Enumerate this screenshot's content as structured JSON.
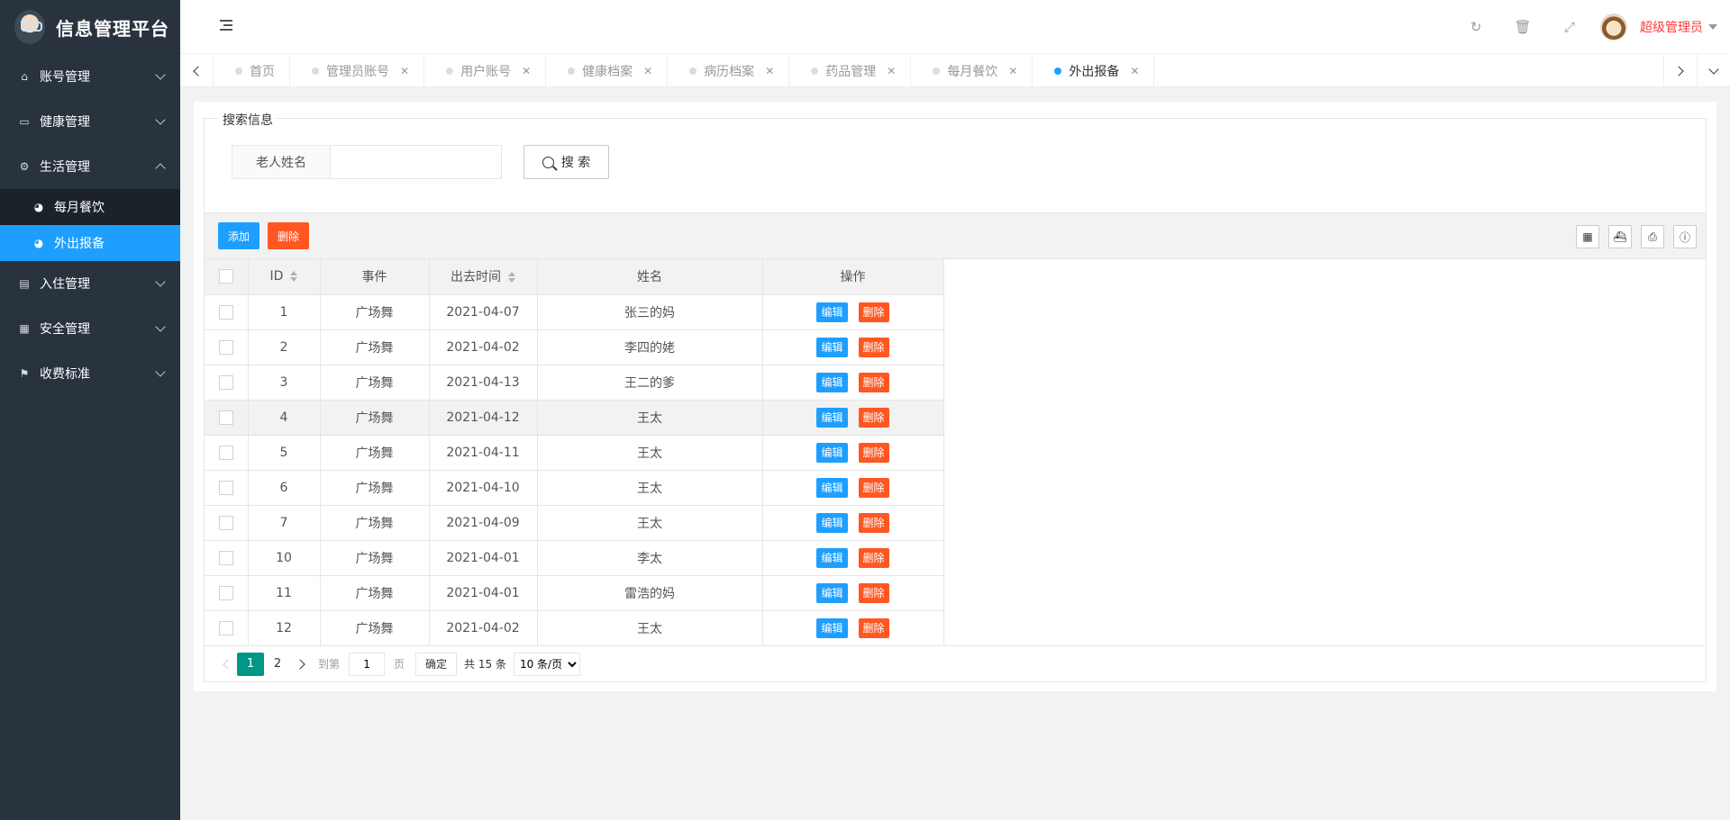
{
  "app": {
    "title": "信息管理平台"
  },
  "sidebar": {
    "items": [
      {
        "label": "账号管理",
        "icon": "home-icon",
        "expanded": false
      },
      {
        "label": "健康管理",
        "icon": "window-icon",
        "expanded": false
      },
      {
        "label": "生活管理",
        "icon": "gears-icon",
        "expanded": true
      },
      {
        "label": "入住管理",
        "icon": "file-icon",
        "expanded": false
      },
      {
        "label": "安全管理",
        "icon": "calendar-icon",
        "expanded": false
      },
      {
        "label": "收费标准",
        "icon": "flag-icon",
        "expanded": false
      }
    ],
    "subitems": [
      {
        "label": "每月餐饮",
        "icon": "dashboard-icon",
        "active": false
      },
      {
        "label": "外出报备",
        "icon": "dashboard-icon",
        "active": true
      }
    ]
  },
  "header": {
    "user": "超级管理员",
    "icons": [
      "refresh-icon",
      "trash-icon",
      "fullscreen-icon"
    ]
  },
  "tabs": [
    {
      "label": "首页",
      "closable": false,
      "active": false
    },
    {
      "label": "管理员账号",
      "closable": true,
      "active": false
    },
    {
      "label": "用户账号",
      "closable": true,
      "active": false
    },
    {
      "label": "健康档案",
      "closable": true,
      "active": false
    },
    {
      "label": "病历档案",
      "closable": true,
      "active": false
    },
    {
      "label": "药品管理",
      "closable": true,
      "active": false
    },
    {
      "label": "每月餐饮",
      "closable": true,
      "active": false
    },
    {
      "label": "外出报备",
      "closable": true,
      "active": true
    }
  ],
  "search": {
    "legend": "搜索信息",
    "label": "老人姓名",
    "value": "",
    "placeholder": "",
    "button": "搜 索"
  },
  "toolbar": {
    "add": "添加",
    "delete": "删除"
  },
  "table": {
    "columns": [
      "ID",
      "事件",
      "出去时间",
      "姓名",
      "操作"
    ],
    "edit_label": "编辑",
    "delete_label": "删除",
    "rows": [
      {
        "id": "1",
        "event": "广场舞",
        "time": "2021-04-07",
        "name": "张三的妈"
      },
      {
        "id": "2",
        "event": "广场舞",
        "time": "2021-04-02",
        "name": "李四的姥"
      },
      {
        "id": "3",
        "event": "广场舞",
        "time": "2021-04-13",
        "name": "王二的爹"
      },
      {
        "id": "4",
        "event": "广场舞",
        "time": "2021-04-12",
        "name": "王太"
      },
      {
        "id": "5",
        "event": "广场舞",
        "time": "2021-04-11",
        "name": "王太"
      },
      {
        "id": "6",
        "event": "广场舞",
        "time": "2021-04-10",
        "name": "王太"
      },
      {
        "id": "7",
        "event": "广场舞",
        "time": "2021-04-09",
        "name": "王太"
      },
      {
        "id": "10",
        "event": "广场舞",
        "time": "2021-04-01",
        "name": "李太"
      },
      {
        "id": "11",
        "event": "广场舞",
        "time": "2021-04-01",
        "name": "雷浩的妈"
      },
      {
        "id": "12",
        "event": "广场舞",
        "time": "2021-04-02",
        "name": "王太"
      }
    ]
  },
  "pager": {
    "pages": [
      "1",
      "2"
    ],
    "current": "1",
    "goto_prefix": "到第",
    "goto_value": "1",
    "goto_suffix": "页",
    "confirm": "确定",
    "total": "共 15 条",
    "per_page": "10 条/页"
  }
}
